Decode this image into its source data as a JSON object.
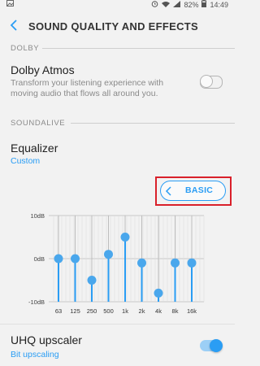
{
  "status": {
    "battery": "82%",
    "time": "14:49"
  },
  "app": {
    "title": "SOUND QUALITY AND EFFECTS"
  },
  "sections": {
    "dolby_header": "DOLBY",
    "soundalive_header": "SOUNDALIVE"
  },
  "dolby_atmos": {
    "title": "Dolby Atmos",
    "description": "Transform your listening experience with moving audio that flows all around you.",
    "enabled": false
  },
  "equalizer": {
    "title": "Equalizer",
    "subtitle": "Custom",
    "mode_button": "BASIC"
  },
  "eq_graph": {
    "db_labels": [
      "10dB",
      "0dB",
      "-10dB"
    ],
    "db_range": [
      -10,
      10
    ],
    "bands": [
      {
        "label": "63",
        "value": 0
      },
      {
        "label": "125",
        "value": 0
      },
      {
        "label": "250",
        "value": -5
      },
      {
        "label": "500",
        "value": 1
      },
      {
        "label": "1k",
        "value": 5
      },
      {
        "label": "2k",
        "value": -1
      },
      {
        "label": "4k",
        "value": -8
      },
      {
        "label": "8k",
        "value": -1
      },
      {
        "label": "16k",
        "value": -1
      }
    ]
  },
  "uhq": {
    "title": "UHQ upscaler",
    "subtitle": "Bit upscaling",
    "enabled": true
  },
  "colors": {
    "accent": "#2a9df4",
    "highlight": "#d9202a"
  }
}
